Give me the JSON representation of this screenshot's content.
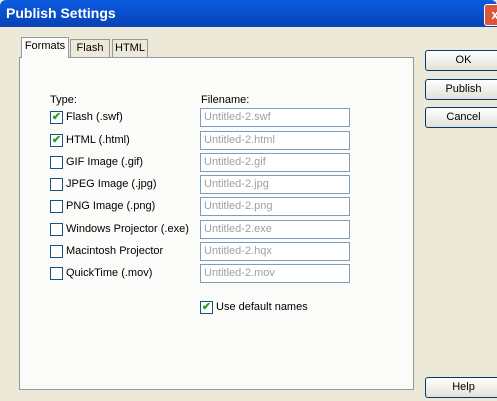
{
  "window": {
    "title": "Publish Settings",
    "close_glyph": "x"
  },
  "tabs": [
    {
      "label": "Formats",
      "active": true
    },
    {
      "label": "Flash",
      "active": false
    },
    {
      "label": "HTML",
      "active": false
    }
  ],
  "formats": {
    "type_header": "Type:",
    "filename_header": "Filename:",
    "rows": [
      {
        "label": "Flash  (.swf)",
        "checked": true,
        "filename": "Untitled-2.swf"
      },
      {
        "label": "HTML (.html)",
        "checked": true,
        "filename": "Untitled-2.html"
      },
      {
        "label": "GIF Image (.gif)",
        "checked": false,
        "filename": "Untitled-2.gif"
      },
      {
        "label": "JPEG Image (.jpg)",
        "checked": false,
        "filename": "Untitled-2.jpg"
      },
      {
        "label": "PNG Image (.png)",
        "checked": false,
        "filename": "Untitled-2.png"
      },
      {
        "label": "Windows Projector (.exe)",
        "checked": false,
        "filename": "Untitled-2.exe"
      },
      {
        "label": "Macintosh Projector",
        "checked": false,
        "filename": "Untitled-2.hqx"
      },
      {
        "label": "QuickTime (.mov)",
        "checked": false,
        "filename": "Untitled-2.mov"
      }
    ],
    "use_default_names": {
      "label": "Use default names",
      "checked": true
    }
  },
  "buttons": {
    "ok": "OK",
    "publish": "Publish",
    "cancel": "Cancel",
    "help": "Help"
  },
  "colors": {
    "titlebar": "#0a5be0",
    "check": "#21a121",
    "dialog_bg": "#ece9d8"
  }
}
